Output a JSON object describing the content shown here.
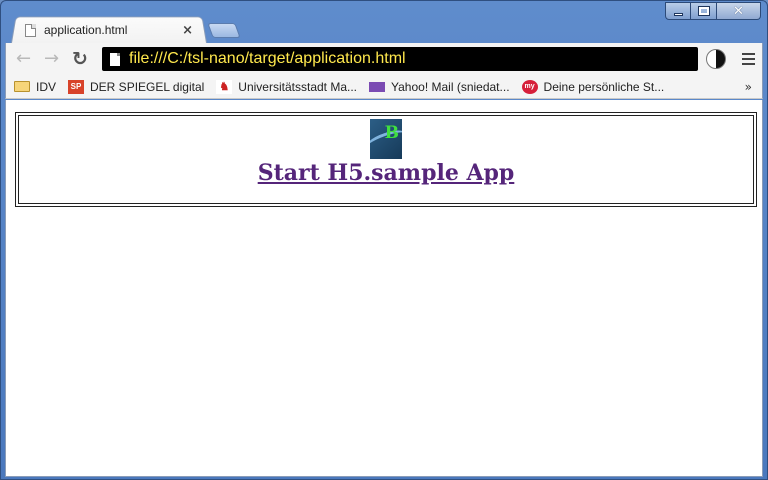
{
  "browser": {
    "tab_title": "application.html",
    "tab_close": "×",
    "url": "file:///C:/tsl-nano/target/application.html",
    "nav": {
      "back": "←",
      "forward": "→",
      "reload": "↻"
    }
  },
  "bookmarks": {
    "items": [
      {
        "label": "IDV",
        "icon": "folder-icon"
      },
      {
        "label": "DER SPIEGEL digital",
        "icon": "spiegel-icon",
        "glyph": "SP"
      },
      {
        "label": "Universitätsstadt Ma...",
        "icon": "university-icon",
        "glyph": "♞"
      },
      {
        "label": "Yahoo! Mail (sniedat...",
        "icon": "mail-icon"
      },
      {
        "label": "Deine persönliche St...",
        "icon": "my-icon",
        "glyph": "my"
      }
    ],
    "overflow": "»"
  },
  "page": {
    "logo_letter": "B",
    "link_text": "Start H5.sample App"
  }
}
